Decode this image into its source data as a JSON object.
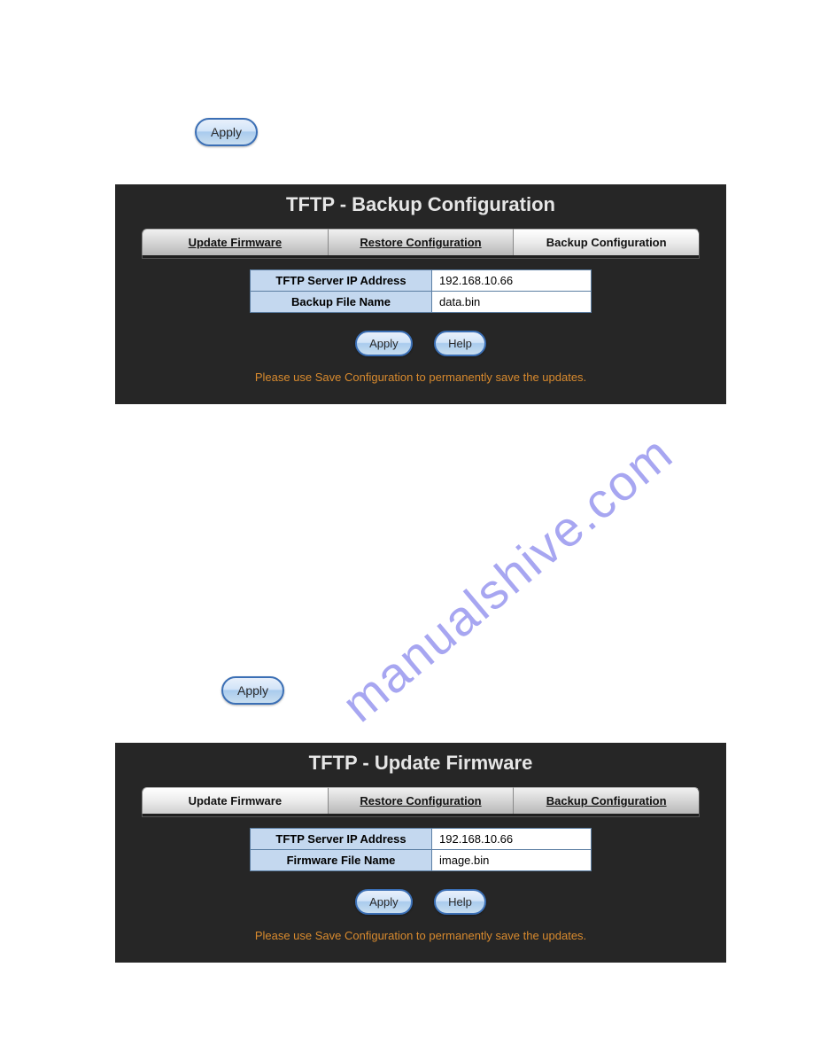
{
  "standalone": {
    "apply_label": "Apply"
  },
  "panel_backup": {
    "title": "TFTP - Backup Configuration",
    "tabs": {
      "update": "Update Firmware",
      "restore": "Restore Configuration",
      "backup": "Backup Configuration"
    },
    "fields": {
      "ip_label": "TFTP Server IP Address",
      "ip_value": "192.168.10.66",
      "file_label": "Backup File Name",
      "file_value": "data.bin"
    },
    "buttons": {
      "apply": "Apply",
      "help": "Help"
    },
    "hint": "Please use Save Configuration to permanently save the updates."
  },
  "panel_update": {
    "title": "TFTP - Update Firmware",
    "tabs": {
      "update": "Update Firmware",
      "restore": "Restore Configuration",
      "backup": "Backup Configuration"
    },
    "fields": {
      "ip_label": "TFTP Server IP Address",
      "ip_value": "192.168.10.66",
      "file_label": "Firmware File Name",
      "file_value": "image.bin"
    },
    "buttons": {
      "apply": "Apply",
      "help": "Help"
    },
    "hint": "Please use Save Configuration to permanently save the updates."
  },
  "watermark": "manualshive.com"
}
